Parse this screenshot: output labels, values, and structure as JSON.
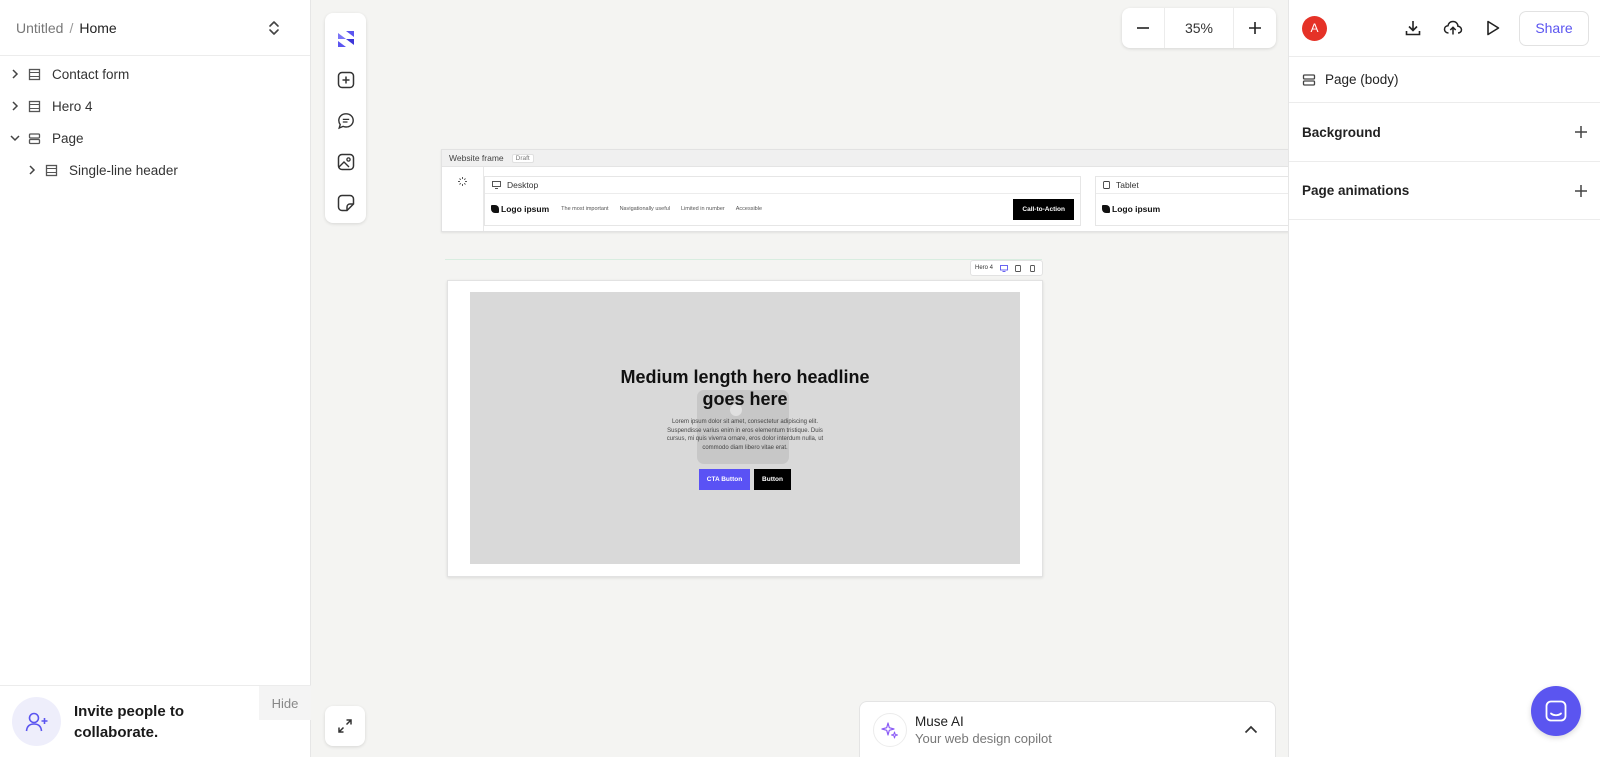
{
  "breadcrumb": {
    "project": "Untitled",
    "separator": "/",
    "page": "Home"
  },
  "layers": [
    {
      "label": "Contact form",
      "expanded": false,
      "indent": 0,
      "icon": "section-icon"
    },
    {
      "label": "Hero 4",
      "expanded": false,
      "indent": 0,
      "icon": "section-icon"
    },
    {
      "label": "Page",
      "expanded": true,
      "indent": 0,
      "icon": "stack-icon"
    },
    {
      "label": "Single-line header",
      "expanded": false,
      "indent": 1,
      "icon": "section-icon"
    }
  ],
  "invite": {
    "text": "Invite people to collaborate.",
    "hide_label": "Hide"
  },
  "zoom": {
    "value": "35%"
  },
  "website_frame": {
    "title": "Website frame",
    "badge": "Draft",
    "desktop": {
      "label": "Desktop",
      "logo": "Logo ipsum",
      "nav": [
        "The most important",
        "Navigationally useful",
        "Limited in number",
        "Accessible"
      ],
      "cta": "Call-to-Action"
    },
    "tablet": {
      "label": "Tablet",
      "logo": "Logo ipsum"
    }
  },
  "hero": {
    "tag": "Hero 4",
    "headline": "Medium length hero headline goes here",
    "body": "Lorem ipsum dolor sit amet, consectetur adipiscing elit. Suspendisse varius enim in eros elementum tristique. Duis cursus, mi quis viverra ornare, eros dolor interdum nulla, ut commodo diam libero vitae erat.",
    "cta_button": "CTA Button",
    "secondary_button": "Button"
  },
  "muse": {
    "title": "Muse AI",
    "subtitle": "Your web design copilot"
  },
  "right_panel": {
    "user_initial": "A",
    "share_label": "Share",
    "selection": "Page (body)",
    "sections": [
      "Background",
      "Page animations"
    ]
  },
  "colors": {
    "accent": "#5b55f0",
    "user_avatar": "#e53227",
    "canvas": "#f4f4f2"
  }
}
